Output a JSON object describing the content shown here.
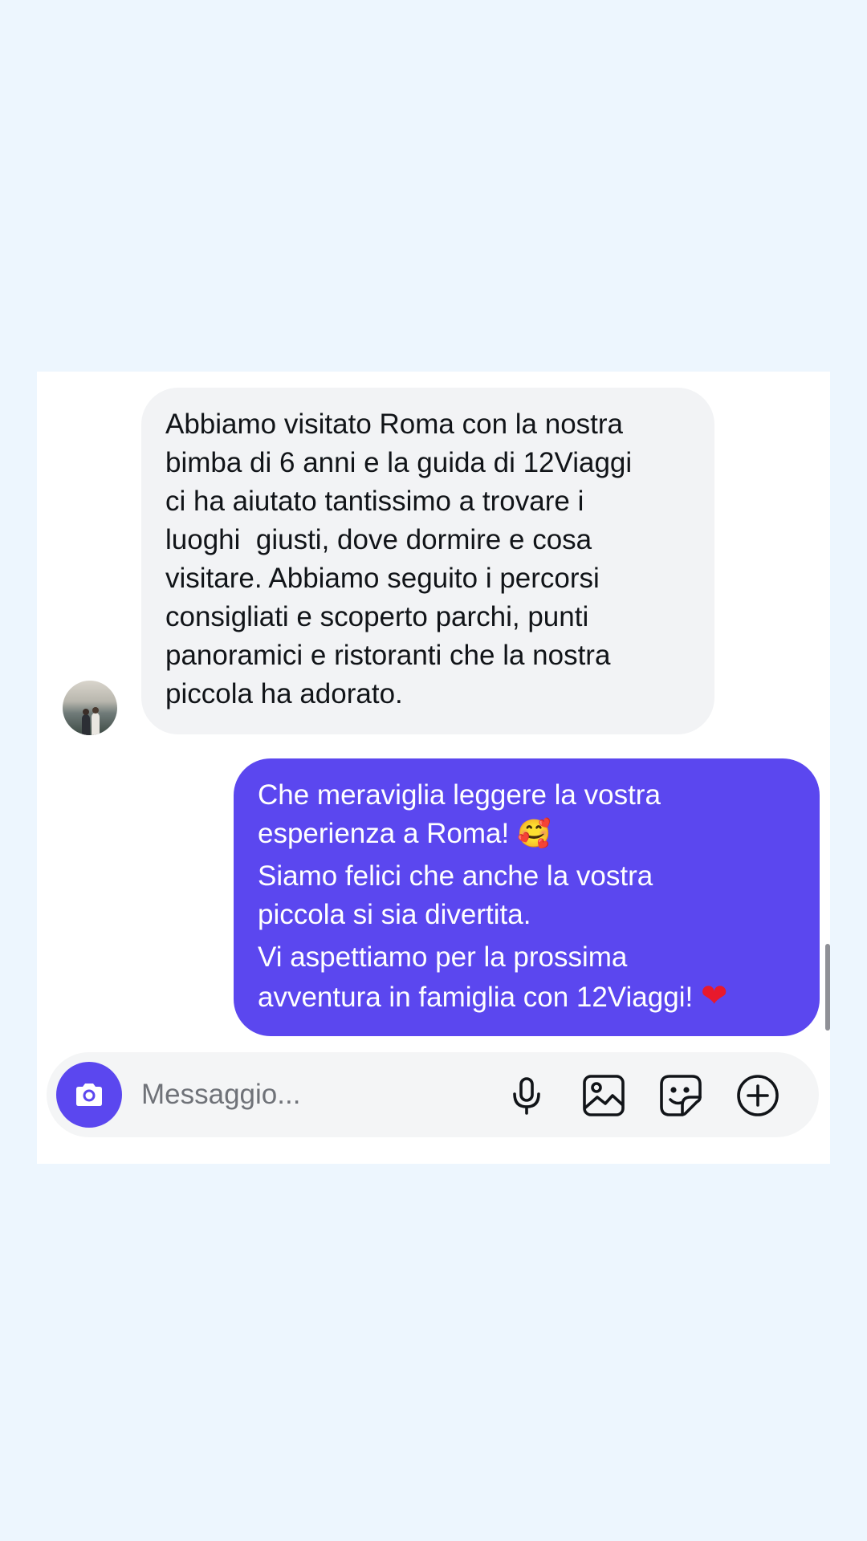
{
  "incoming_message": {
    "lines": [
      "Abbiamo visitato Roma con la nostra",
      "bimba di 6 anni e la guida di 12Viaggi",
      "ci ha aiutato tantissimo a trovare i",
      "luoghi  giusti, dove dormire e cosa",
      "visitare. Abbiamo seguito i percorsi",
      "consigliati e scoperto parchi, punti",
      "panoramici e ristoranti che la nostra",
      "piccola ha adorato."
    ]
  },
  "outgoing_message": {
    "line1": "Che meraviglia leggere la vostra",
    "line2": "esperienza a Roma! ",
    "line2_emoji": "🥰",
    "line3": "Siamo felici che anche la vostra",
    "line4": "piccola si sia divertita.",
    "line5": "Vi aspettiamo per la prossima",
    "line6": "avventura in famiglia con 12Viaggi! ",
    "line6_emoji": "❤"
  },
  "composer": {
    "placeholder": "Messaggio...",
    "value": ""
  },
  "icons": {
    "camera": "camera-icon",
    "microphone": "microphone-icon",
    "gallery": "image-icon",
    "sticker": "sticker-icon",
    "more": "plus-circle-icon"
  },
  "colors": {
    "accent": "#5b47ef",
    "incoming_bubble": "#f2f3f5",
    "background": "#edf6fe"
  }
}
